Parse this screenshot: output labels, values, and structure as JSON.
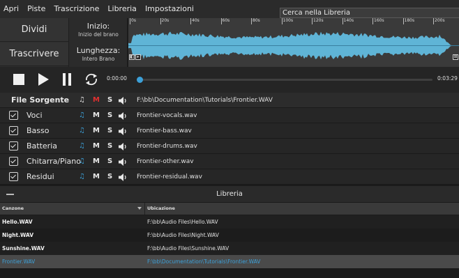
{
  "menu": {
    "items": [
      "Apri",
      "Piste",
      "Trascrizione",
      "Libreria",
      "Impostazioni"
    ]
  },
  "search": {
    "placeholder": "Cerca nella Libreria"
  },
  "left_buttons": {
    "split": "Dividi",
    "transcribe": "Trascrivere"
  },
  "range": {
    "start_label": "Inizio:",
    "start_value": "Inizio del brano",
    "length_label": "Lunghezza:",
    "length_value": "Intero Brano"
  },
  "ruler": {
    "ticks": [
      "0s",
      "20s",
      "40s",
      "60s",
      "80s",
      "100s",
      "120s",
      "140s",
      "160s",
      "180s",
      "200s"
    ]
  },
  "transport": {
    "current_time": "0:00:00",
    "total_time": "0:03:29",
    "progress": 0.0
  },
  "tracks": {
    "source": {
      "name": "File Sorgente",
      "note": "♫",
      "mute": "M",
      "solo": "S",
      "file": "F:\\bb\\Documentation\\Tutorials\\Frontier.WAV"
    },
    "stems": [
      {
        "name": "Voci",
        "note": "♫",
        "mute": "M",
        "solo": "S",
        "file": "Frontier-vocals.wav"
      },
      {
        "name": "Basso",
        "note": "♫",
        "mute": "M",
        "solo": "S",
        "file": "Frontier-bass.wav"
      },
      {
        "name": "Batteria",
        "note": "♫",
        "mute": "M",
        "solo": "S",
        "file": "Frontier-drums.wav"
      },
      {
        "name": "Chitarra/Piano",
        "note": "♫",
        "mute": "M",
        "solo": "S",
        "file": "Frontier-other.wav"
      },
      {
        "name": "Residui",
        "note": "♫",
        "mute": "M",
        "solo": "S",
        "file": "Frontier-residual.wav"
      }
    ]
  },
  "library": {
    "title": "Libreria",
    "columns": {
      "song": "Canzone",
      "location": "Ubicazione"
    },
    "rows": [
      {
        "song": "Hello.WAV",
        "location": "F:\\bb\\Audio Files\\Hello.WAV"
      },
      {
        "song": "Night.WAV",
        "location": "F:\\bb\\Audio Files\\Night.WAV"
      },
      {
        "song": "Sunshine.WAV",
        "location": "F:\\bb\\Audio Files\\Sunshine.WAV"
      },
      {
        "song": "Frontier.WAV",
        "location": "F:\\bb\\Documentation\\Tutorials\\Frontier.WAV"
      }
    ]
  },
  "colors": {
    "accent": "#3ca0d8",
    "mute_active": "#e03030",
    "wave": "#5fb4d6"
  }
}
